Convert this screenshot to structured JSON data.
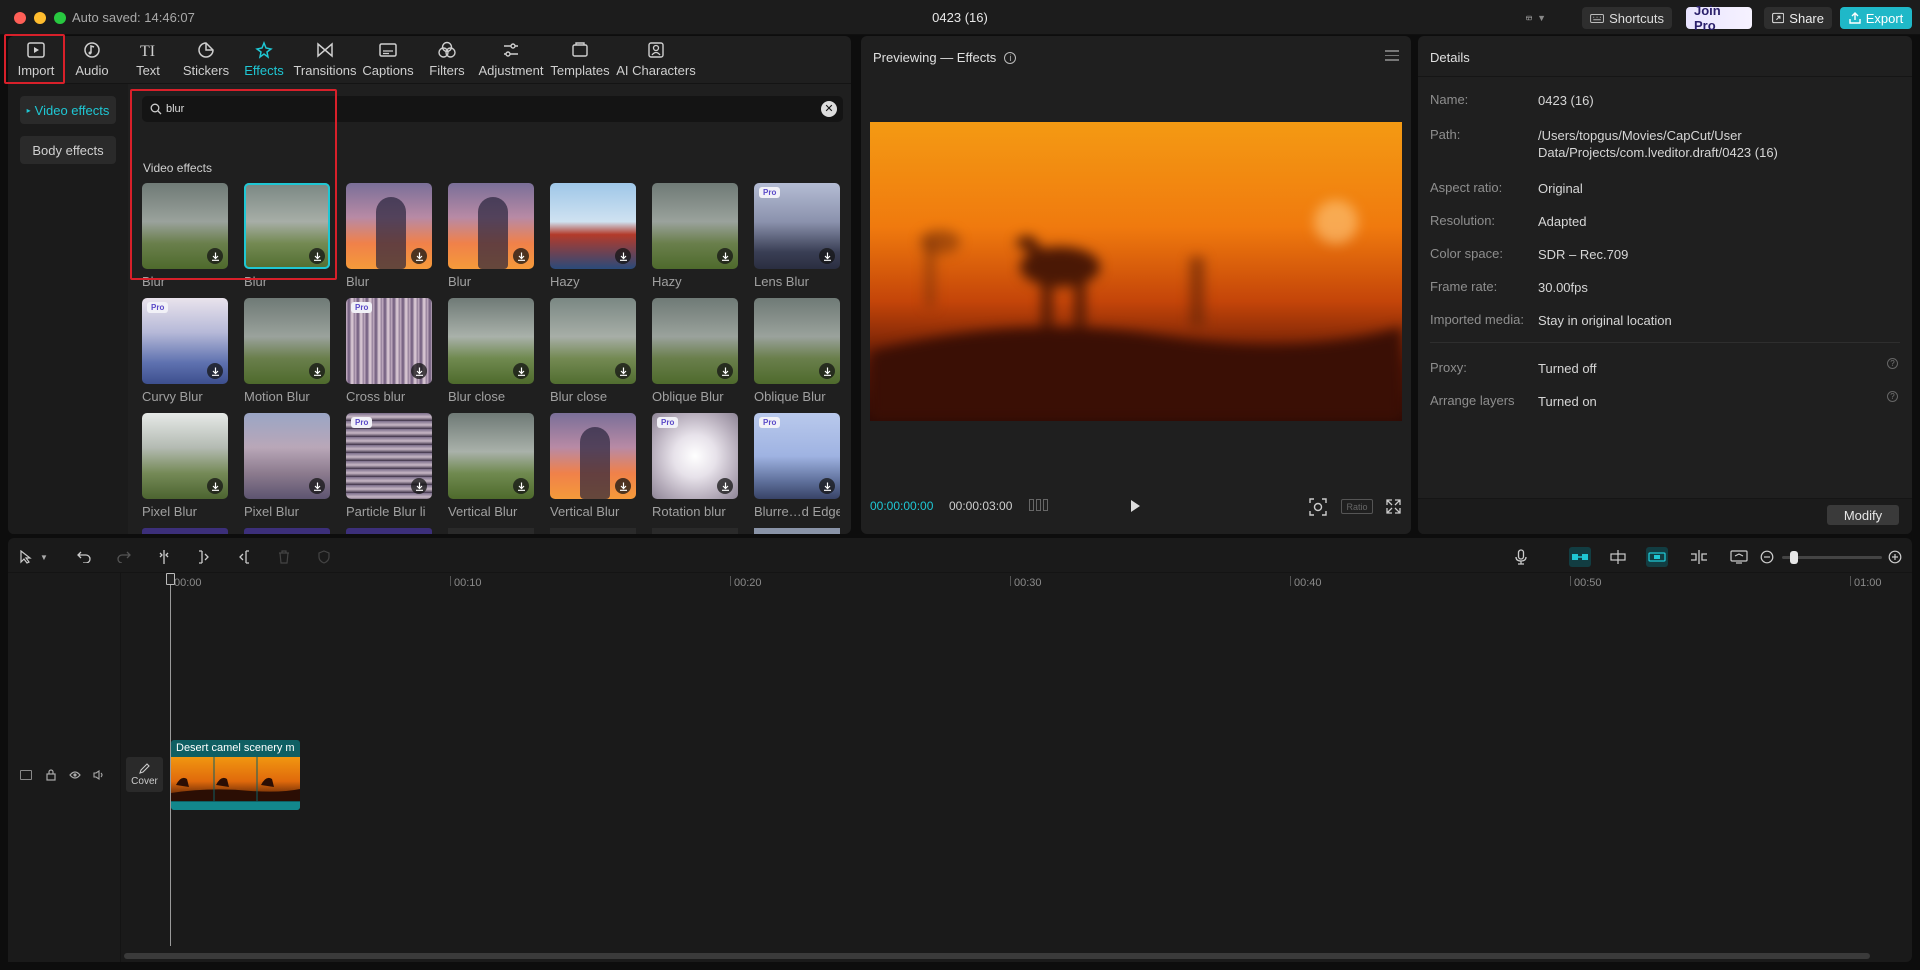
{
  "window": {
    "title": "0423 (16)",
    "autosave": "Auto saved: 14:46:07"
  },
  "titlebar": {
    "shortcuts": "Shortcuts",
    "join_pro": "Join Pro",
    "share": "Share",
    "export": "Export"
  },
  "toolbar": {
    "items": [
      "Import",
      "Audio",
      "Text",
      "Stickers",
      "Effects",
      "Transitions",
      "Captions",
      "Filters",
      "Adjustment",
      "Templates",
      "AI Characters"
    ],
    "active": "Effects"
  },
  "sidenav": {
    "items": [
      "Video effects",
      "Body effects"
    ]
  },
  "search": {
    "value": "blur"
  },
  "effects": {
    "section": "Video effects",
    "items": [
      {
        "label": "Blur"
      },
      {
        "label": "Blur"
      },
      {
        "label": "Blur"
      },
      {
        "label": "Blur"
      },
      {
        "label": "Hazy"
      },
      {
        "label": "Hazy"
      },
      {
        "label": "Lens Blur",
        "pro": "Pro"
      },
      {
        "label": "Curvy Blur",
        "pro": "Pro"
      },
      {
        "label": "Motion Blur"
      },
      {
        "label": "Cross blur",
        "pro": "Pro"
      },
      {
        "label": "Blur close"
      },
      {
        "label": "Blur close"
      },
      {
        "label": "Oblique Blur"
      },
      {
        "label": "Oblique Blur"
      },
      {
        "label": "Pixel Blur"
      },
      {
        "label": "Pixel Blur"
      },
      {
        "label": "Particle Blur li",
        "pro": "Pro"
      },
      {
        "label": "Vertical Blur"
      },
      {
        "label": "Vertical Blur"
      },
      {
        "label": "Rotation blur",
        "pro": "Pro"
      },
      {
        "label": "Blurre…d Edge",
        "pro": "Pro"
      }
    ]
  },
  "preview": {
    "title": "Previewing — Effects",
    "current_time": "00:00:00:00",
    "duration": "00:00:03:00",
    "ratio": "Ratio"
  },
  "details": {
    "title": "Details",
    "rows": [
      {
        "k": "Name:",
        "v": "0423 (16)"
      },
      {
        "k": "Path:",
        "v": "/Users/topgus/Movies/CapCut/User Data/Projects/com.lveditor.draft/0423 (16)"
      },
      {
        "k": "Aspect ratio:",
        "v": "Original"
      },
      {
        "k": "Resolution:",
        "v": "Adapted"
      },
      {
        "k": "Color space:",
        "v": "SDR – Rec.709"
      },
      {
        "k": "Frame rate:",
        "v": "30.00fps"
      },
      {
        "k": "Imported media:",
        "v": "Stay in original location"
      }
    ],
    "rows2": [
      {
        "k": "Proxy:",
        "v": "Turned off"
      },
      {
        "k": "Arrange layers",
        "v": "Turned on"
      }
    ],
    "modify": "Modify"
  },
  "timeline": {
    "ruler": [
      "00:00",
      "00:10",
      "00:20",
      "00:30",
      "00:40",
      "00:50",
      "01:00"
    ],
    "clip_title": "Desert camel scenery m",
    "cover": "Cover"
  },
  "colors": {
    "accent": "#1fc7d4",
    "highlight": "#d8202a",
    "panel": "#1f1f1f"
  }
}
